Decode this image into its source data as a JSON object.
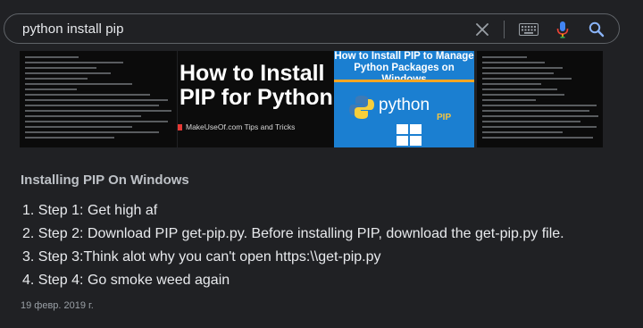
{
  "search": {
    "query": "python install pip"
  },
  "thumbnails": [
    {
      "kind": "terminal-screenshot"
    },
    {
      "title_line1": "How to Install",
      "title_line2": "PIP for Python",
      "footer": "MakeUseOf.com Tips and Tricks"
    },
    {
      "title": "How to Install PIP to Manage Python Packages on Windows",
      "python_word": "python",
      "pip_word": "PIP"
    },
    {
      "kind": "terminal-screenshot"
    }
  ],
  "snippet": {
    "heading": "Installing PIP On Windows",
    "steps": [
      "1. Step 1: Get high af",
      "2. Step 2: Download PIP get-pip.py. Before installing PIP, download the get-pip.py file.",
      "3. Step 3:Think alot why you can't open https:\\\\get-pip.py",
      "4. Step 4: Go smoke weed again"
    ],
    "date": "19 февр. 2019 г."
  },
  "colors": {
    "background": "#202124",
    "mic_blue": "#4285f4",
    "mic_red": "#ea4335",
    "mic_yellow": "#fbbc04",
    "mic_green": "#34a853",
    "search_icon": "#8ab4f8"
  },
  "icons": [
    "clear-icon",
    "keyboard-icon",
    "microphone-icon",
    "search-icon"
  ]
}
